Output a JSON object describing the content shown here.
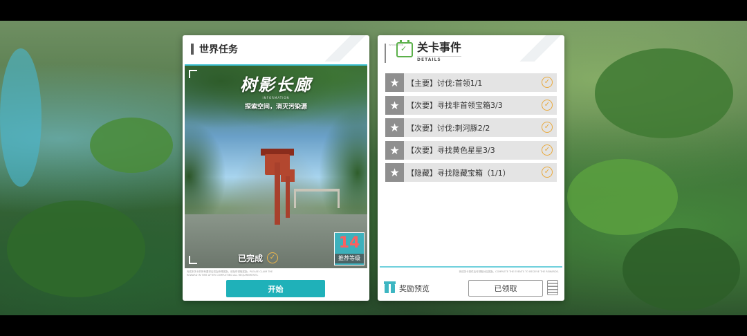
{
  "world_mission": {
    "title": "世界任务",
    "stage_name": "树影长廊",
    "info_label": "INFORMATION",
    "stage_desc": "探索空间，消灭污染源",
    "status": "已完成",
    "recommended_level": "14",
    "recommended_level_label": "推荐等级",
    "fine_print": "完成本关卡的所有要求后将会获得奖励，请及时领取奖励。PLEASE CLAIM THE REWARD IN TIME AFTER COMPLETING ALL REQUIREMENTS.",
    "start_label": "开始"
  },
  "stage_events": {
    "title": "关卡事件",
    "subtitle": "DETAILS",
    "side_label": "INFORMATION",
    "events": [
      {
        "text": "【主要】讨伐:首领1/1",
        "done": true
      },
      {
        "text": "【次要】寻找非首领宝箱3/3",
        "done": true
      },
      {
        "text": "【次要】讨伐:刺河豚2/2",
        "done": true
      },
      {
        "text": "【次要】寻找黄色星星3/3",
        "done": true
      },
      {
        "text": "【隐藏】寻找隐藏宝箱（1/1）",
        "done": true
      }
    ],
    "fine_print": "完成关卡事件后可领取对应奖励。COMPLETE THE EVENTS TO RECEIVE THE REWARDS.",
    "reward_preview_label": "奖励预览",
    "claimed_label": "已领取"
  },
  "icons": {
    "star": "★",
    "check": "✓"
  },
  "colors": {
    "accent_cyan": "#1fb1b9",
    "check_orange": "#e9a83a",
    "level_red": "#ff5f5f",
    "calendar_green": "#5bb04a"
  }
}
